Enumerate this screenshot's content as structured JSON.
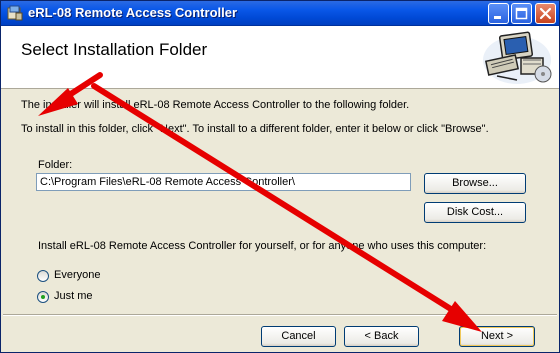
{
  "window": {
    "title": "eRL-08 Remote Access Controller",
    "controls": {
      "minimize": "minimize-icon",
      "maximize": "maximize-icon",
      "close": "close-icon"
    }
  },
  "header": {
    "title": "Select Installation Folder",
    "art_icon": "computer-setup-icon"
  },
  "body": {
    "intro": "The installer will install eRL-08 Remote Access Controller to the following folder.",
    "instructions": "To install in this folder, click \"Next\". To install to a different folder, enter it below or click \"Browse\".",
    "folder_label": "Folder:",
    "folder_value": "C:\\Program Files\\eRL-08 Remote Access Controller\\",
    "browse_label": "Browse...",
    "disk_cost_label": "Disk Cost...",
    "install_for_text": "Install eRL-08 Remote Access Controller for yourself, or for anyone who uses this computer:",
    "radio_options": [
      {
        "label": "Everyone",
        "selected": false
      },
      {
        "label": "Just me",
        "selected": true
      }
    ]
  },
  "footer": {
    "cancel_label": "Cancel",
    "back_label": "< Back",
    "next_label": "Next >"
  },
  "annotations": {
    "arrow_color": "#e60000"
  }
}
